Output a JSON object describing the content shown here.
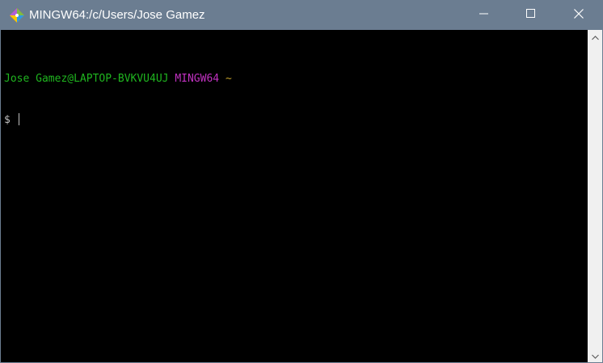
{
  "window": {
    "title": "MINGW64:/c/Users/Jose Gamez",
    "icon": "git-bash-icon"
  },
  "controls": {
    "minimize_icon": "minimize-icon",
    "maximize_icon": "maximize-icon",
    "close_icon": "close-icon"
  },
  "terminal": {
    "user_host": "Jose Gamez@LAPTOP-BVKVU4UJ",
    "environment": "MINGW64",
    "cwd": "~",
    "prompt": "$"
  },
  "colors": {
    "titlebar": "#6b7d91",
    "background": "#000000",
    "user_host": "#1fb51f",
    "environment": "#c232c2",
    "cwd": "#c2a02a",
    "text": "#c0c0c0"
  }
}
